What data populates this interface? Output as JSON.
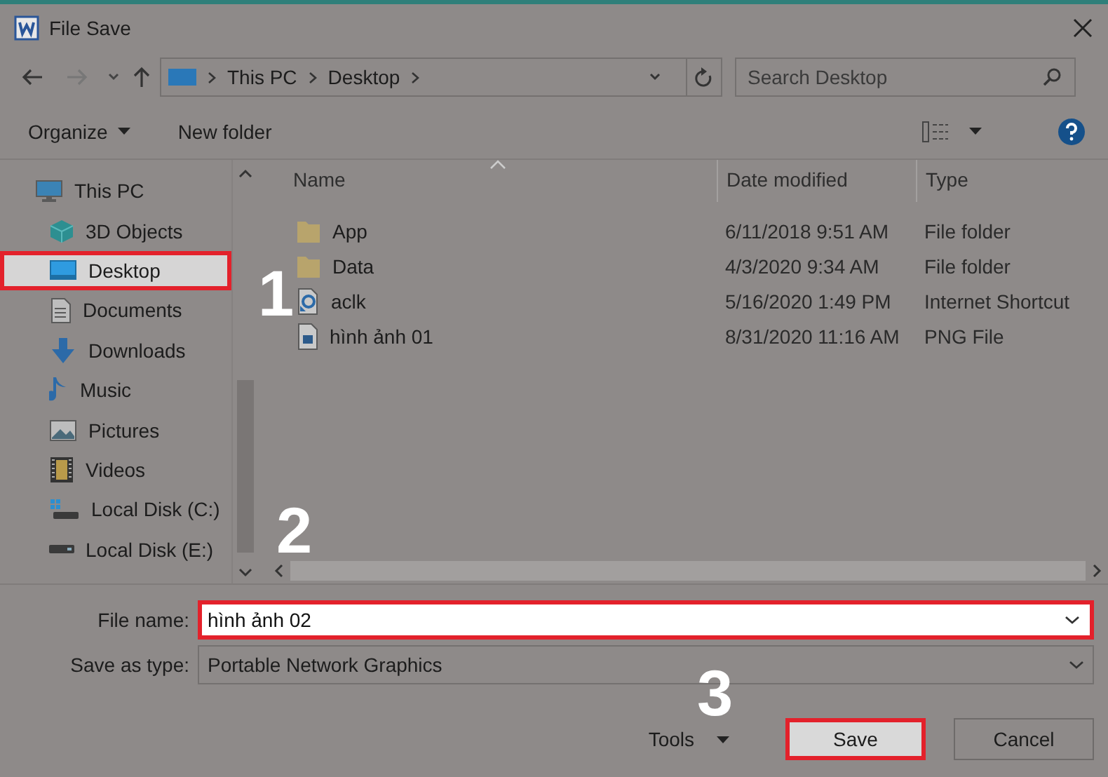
{
  "window": {
    "title": "File Save"
  },
  "address_bar": {
    "breadcrumbs": [
      "This PC",
      "Desktop"
    ]
  },
  "search": {
    "placeholder": "Search Desktop"
  },
  "toolbar": {
    "buttons": [
      {
        "label": "Organize",
        "kind": "menu"
      },
      {
        "label": "New folder",
        "kind": "button"
      }
    ]
  },
  "sidebar": {
    "items": [
      {
        "label": "This PC",
        "kind": "pc",
        "selected": false,
        "highlighted": false,
        "children": [
          {
            "label": "3D Objects",
            "kind": "cube",
            "selected": false,
            "highlighted": false
          },
          {
            "label": "Desktop",
            "kind": "desktop",
            "selected": true,
            "highlighted": true
          },
          {
            "label": "Documents",
            "kind": "document",
            "selected": false,
            "highlighted": false
          },
          {
            "label": "Downloads",
            "kind": "download",
            "selected": false,
            "highlighted": false
          },
          {
            "label": "Music",
            "kind": "music",
            "selected": false,
            "highlighted": false
          },
          {
            "label": "Pictures",
            "kind": "picture",
            "selected": false,
            "highlighted": false
          },
          {
            "label": "Videos",
            "kind": "video",
            "selected": false,
            "highlighted": false
          },
          {
            "label": "Local Disk (C:)",
            "kind": "system-disk",
            "selected": false,
            "highlighted": false
          },
          {
            "label": "Local Disk (E:)",
            "kind": "disk",
            "selected": false,
            "highlighted": false
          }
        ]
      }
    ]
  },
  "file_list": {
    "columns": [
      "Name",
      "Date modified",
      "Type"
    ],
    "rows": [
      {
        "name": "App",
        "date": "6/11/2018 9:51 AM",
        "type": "File folder",
        "kind": "folder"
      },
      {
        "name": "Data",
        "date": "4/3/2020 9:34 AM",
        "type": "File folder",
        "kind": "folder"
      },
      {
        "name": "aclk",
        "date": "5/16/2020 1:49 PM",
        "type": "Internet Shortcut",
        "kind": "shortcut"
      },
      {
        "name": "hình ảnh 01",
        "date": "8/31/2020 11:16 AM",
        "type": "PNG File",
        "kind": "image"
      }
    ]
  },
  "file_name": {
    "label": "File name:",
    "value": "hình ảnh 02",
    "highlighted": true
  },
  "save_type": {
    "label": "Save as type:",
    "value": "Portable Network Graphics"
  },
  "tools": {
    "label": "Tools"
  },
  "buttons": [
    {
      "label": "Save",
      "highlighted": true
    },
    {
      "label": "Cancel",
      "highlighted": false
    }
  ],
  "annotations": [
    {
      "label": "1"
    },
    {
      "label": "2"
    },
    {
      "label": "3"
    }
  ]
}
